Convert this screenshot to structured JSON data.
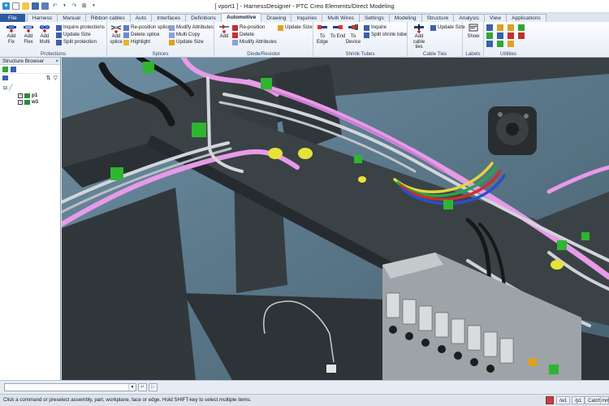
{
  "window": {
    "title": "[ vport1 ] - HarnessDesigner - PTC Creo Elements/Direct Modeling"
  },
  "tabs": [
    {
      "label": "File"
    },
    {
      "label": "Harness"
    },
    {
      "label": "Manual"
    },
    {
      "label": "Ribbon cables"
    },
    {
      "label": "Auto"
    },
    {
      "label": "Interfaces"
    },
    {
      "label": "Definitions"
    },
    {
      "label": "Automotive"
    },
    {
      "label": "Drawing"
    },
    {
      "label": "Inquiries"
    },
    {
      "label": "Multi Wires"
    },
    {
      "label": "Settings"
    },
    {
      "label": "Modeling"
    },
    {
      "label": "Structure"
    },
    {
      "label": "Analysis"
    },
    {
      "label": "View"
    },
    {
      "label": "Applications"
    }
  ],
  "ribbon": {
    "protections": {
      "label": "Protections",
      "add_fix": "Add Fix",
      "add_flex": "Add Flex",
      "add_multi": "Add Multi",
      "inquire": "Inquire protections",
      "update_size": "Update Size",
      "split": "Split protection"
    },
    "splices": {
      "label": "Splices",
      "add_splice": "Add splice",
      "reposition": "Re-position splice",
      "delete": "Delete splice",
      "highlight": "Highlight",
      "modify": "Modify Attributes",
      "multi_copy": "Multi Copy",
      "update_size": "Update Size"
    },
    "diode": {
      "label": "Diode/Resistor",
      "add": "Add",
      "reposition": "Re-position",
      "delete": "Delete",
      "modify": "Modify Attributes",
      "update_size": "Update Size"
    },
    "shrink": {
      "label": "Shrink Tubes",
      "to_edge": "To Edge",
      "to_end": "To End",
      "to_device": "To Device",
      "inquire": "Inquire",
      "split": "Split shrink tube"
    },
    "cable_ties": {
      "label": "Cable Ties",
      "add": "Add cable ties",
      "update_size": "Update Size"
    },
    "labels": {
      "label": "Labels",
      "show": "Show"
    },
    "utilities": {
      "label": "Utilities"
    }
  },
  "browser": {
    "title": "Structure Browser",
    "items": [
      {
        "label": "p1"
      },
      {
        "label": "w1"
      }
    ]
  },
  "command": {
    "value": "",
    "placeholder": ""
  },
  "status": {
    "message": "Click a command or preselect assembly, part, workplane, face or edge. Hold SHIFT-key to select multiple items.",
    "workplane": "/w1",
    "part": "/p1",
    "catch": "Catch",
    "units": "mm"
  },
  "colors": {
    "accent": "#2e5b9a",
    "wire_pink": "#e79ae8",
    "wire_gray": "#d2d6da",
    "clip_green": "#2fb52f",
    "clip_yellow": "#e7e23a",
    "frame": "#3a4144",
    "background": "#5f7f92"
  }
}
